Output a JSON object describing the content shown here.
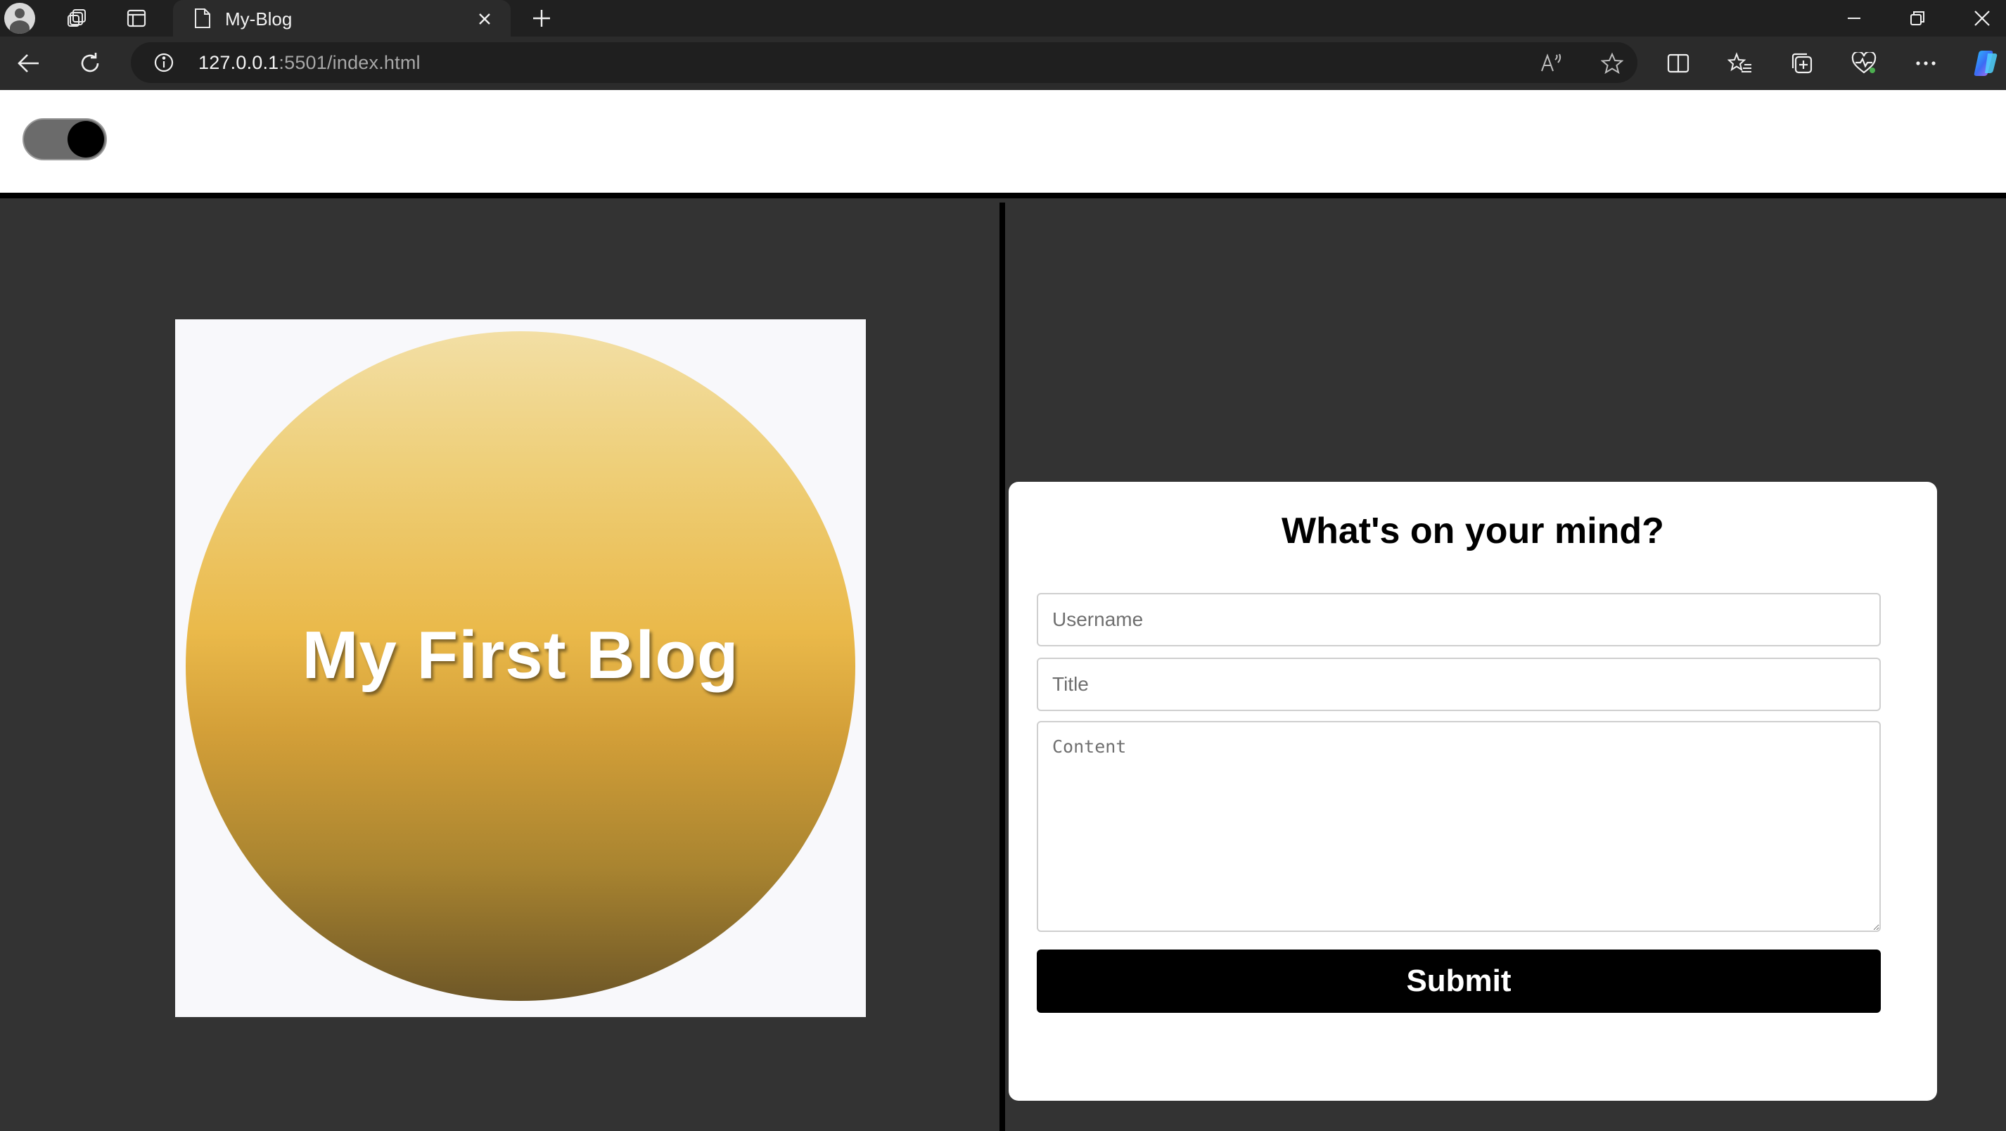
{
  "browser": {
    "tab_title": "My-Blog",
    "url_host": "127.0.0.1",
    "url_rest": ":5501/index.html"
  },
  "page": {
    "theme_toggle": {
      "state": "on"
    },
    "logo": {
      "text": "My First Blog"
    },
    "form": {
      "heading": "What's on your mind?",
      "username_placeholder": "Username",
      "title_placeholder": "Title",
      "content_placeholder": "Content",
      "submit_label": "Submit"
    }
  },
  "colors": {
    "page_background": "#333333",
    "header_background": "#ffffff",
    "submit_background": "#000000",
    "logo_gold": "#eab94a"
  }
}
